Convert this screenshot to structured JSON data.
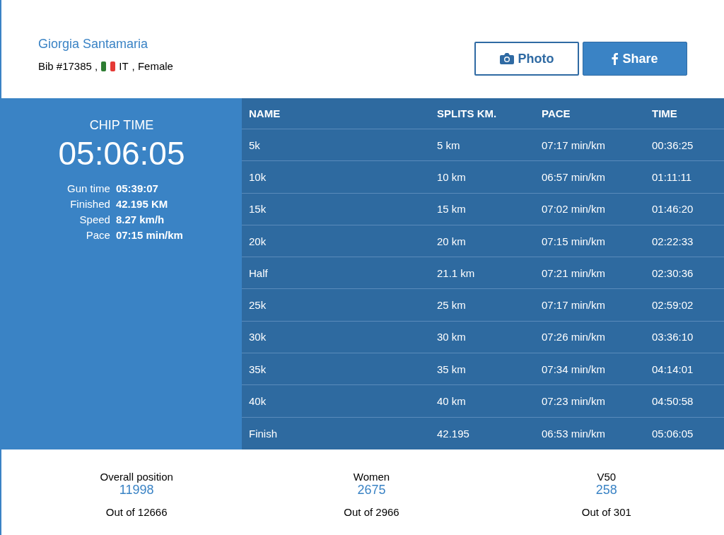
{
  "runner": {
    "name": "Giorgia Santamaria",
    "bib": "Bib #17385 ,",
    "country": "IT",
    "gender": ", Female"
  },
  "buttons": [
    {
      "kind": "photo",
      "label": "Photo"
    },
    {
      "kind": "share",
      "label": "Share"
    }
  ],
  "chip_time": {
    "label": "CHIP TIME",
    "value": "05:06:05"
  },
  "stats": [
    {
      "label": "Gun time",
      "value": "05:39:07"
    },
    {
      "label": "Finished",
      "value": "42.195 KM"
    },
    {
      "label": "Speed",
      "value": "8.27 km/h"
    },
    {
      "label": "Pace",
      "value": "07:15 min/km"
    }
  ],
  "table": {
    "columns": [
      "NAME",
      "SPLITS KM.",
      "PACE",
      "TIME"
    ],
    "rows": [
      [
        "5k",
        "5 km",
        "07:17 min/km",
        "00:36:25"
      ],
      [
        "10k",
        "10 km",
        "06:57 min/km",
        "01:11:11"
      ],
      [
        "15k",
        "15 km",
        "07:02 min/km",
        "01:46:20"
      ],
      [
        "20k",
        "20 km",
        "07:15 min/km",
        "02:22:33"
      ],
      [
        "Half",
        "21.1 km",
        "07:21 min/km",
        "02:30:36"
      ],
      [
        "25k",
        "25 km",
        "07:17 min/km",
        "02:59:02"
      ],
      [
        "30k",
        "30 km",
        "07:26 min/km",
        "03:36:10"
      ],
      [
        "35k",
        "35 km",
        "07:34 min/km",
        "04:14:01"
      ],
      [
        "40k",
        "40 km",
        "07:23 min/km",
        "04:50:58"
      ],
      [
        "Finish",
        "42.195",
        "06:53 min/km",
        "05:06:05"
      ]
    ]
  },
  "positions": [
    {
      "label": "Overall position",
      "value": "11998",
      "total": "Out of 12666"
    },
    {
      "label": "Women",
      "value": "2675",
      "total": "Out of 2966"
    },
    {
      "label": "V50",
      "value": "258",
      "total": "Out of 301"
    }
  ]
}
